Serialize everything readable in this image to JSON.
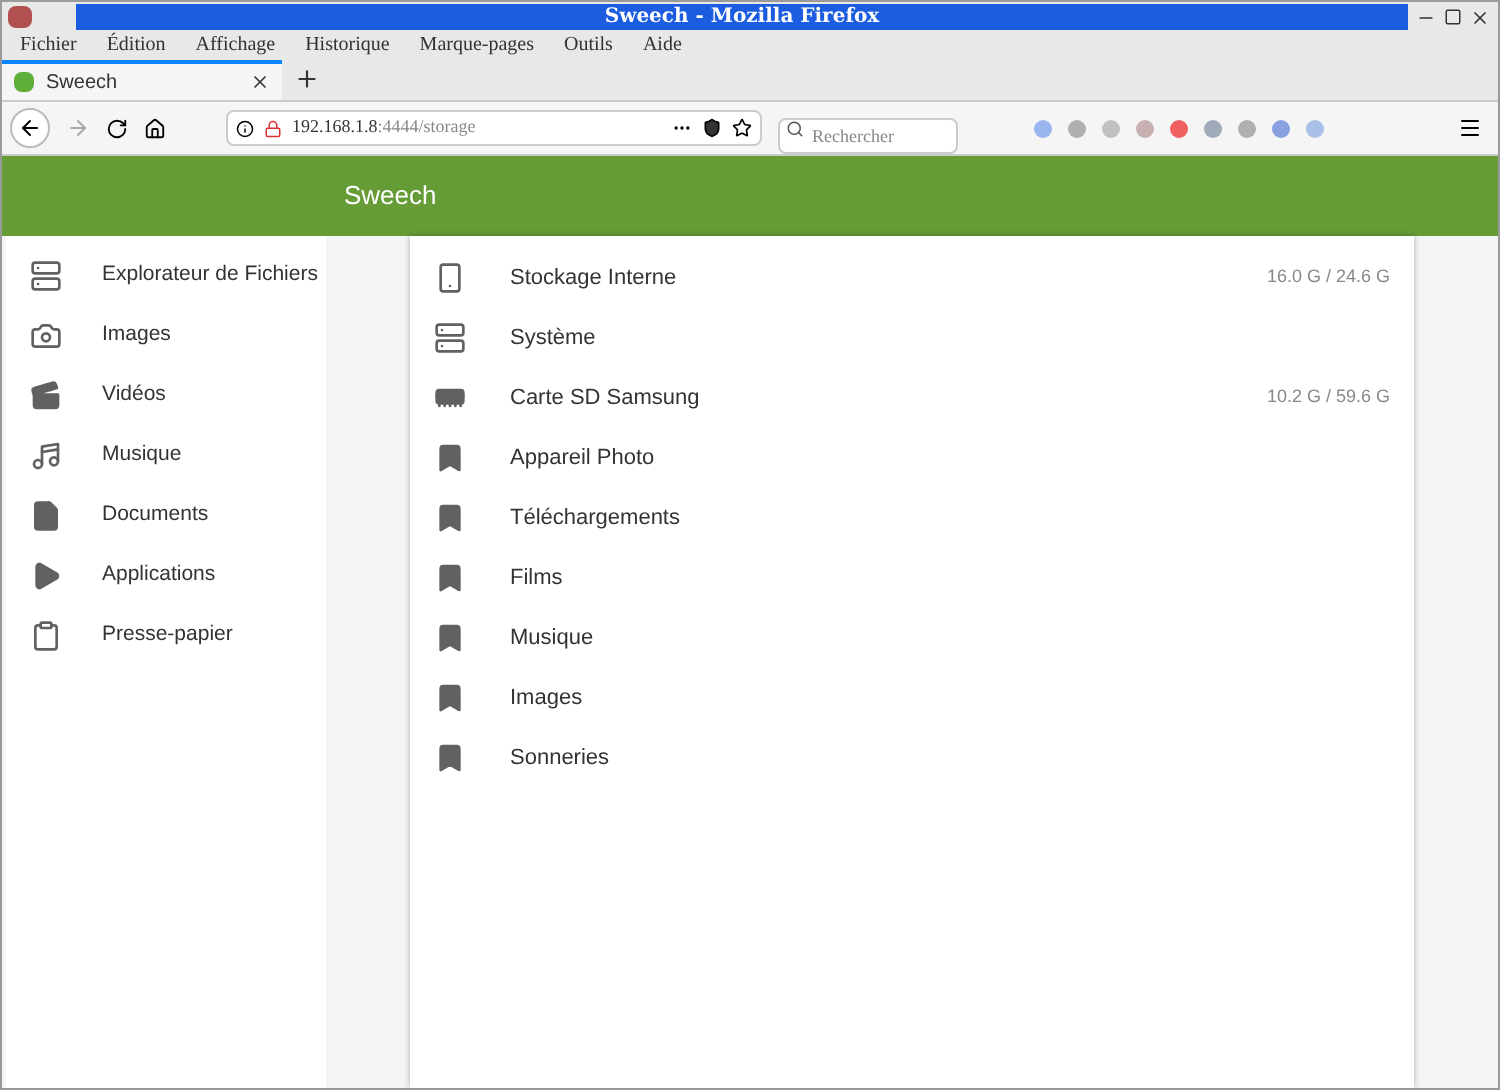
{
  "window": {
    "title": "Sweech - Mozilla Firefox"
  },
  "menu": [
    "Fichier",
    "Édition",
    "Affichage",
    "Historique",
    "Marque-pages",
    "Outils",
    "Aide"
  ],
  "tabs": [
    {
      "label": "Sweech",
      "selected": true
    }
  ],
  "address": {
    "host": "192.168.1.8",
    "path": ":4444/storage"
  },
  "search": {
    "placeholder": "Rechercher"
  },
  "header": {
    "title": "Sweech"
  },
  "sidebar": {
    "items": [
      {
        "label": "Explorateur de Fichiers",
        "kind": "storage"
      },
      {
        "label": "Images",
        "kind": "camera"
      },
      {
        "label": "Vidéos",
        "kind": "video"
      },
      {
        "label": "Musique",
        "kind": "music"
      },
      {
        "label": "Documents",
        "kind": "document"
      },
      {
        "label": "Applications",
        "kind": "apps"
      },
      {
        "label": "Presse-papier",
        "kind": "clipboard"
      }
    ]
  },
  "storage": {
    "items": [
      {
        "label": "Stockage Interne",
        "kind": "phone",
        "usage": "16.0 G / 24.6 G"
      },
      {
        "label": "Système",
        "kind": "storage"
      },
      {
        "label": "Carte SD Samsung",
        "kind": "sdcard",
        "usage": "10.2 G / 59.6 G"
      },
      {
        "label": "Appareil Photo",
        "kind": "bookmark"
      },
      {
        "label": "Téléchargements",
        "kind": "bookmark"
      },
      {
        "label": "Films",
        "kind": "bookmark"
      },
      {
        "label": "Musique",
        "kind": "bookmark"
      },
      {
        "label": "Images",
        "kind": "bookmark"
      },
      {
        "label": "Sonneries",
        "kind": "bookmark"
      }
    ]
  }
}
